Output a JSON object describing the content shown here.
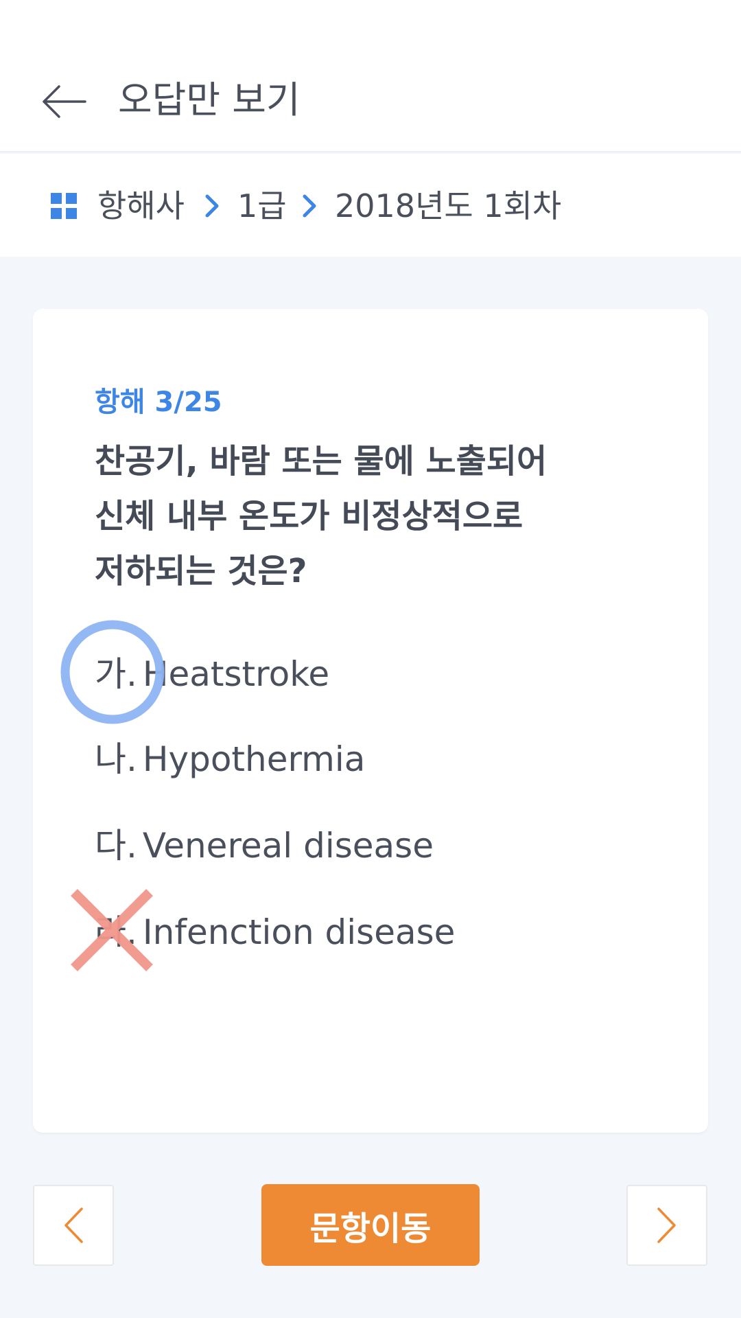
{
  "header": {
    "title": "오답만 보기",
    "back_icon": "arrow-left-icon"
  },
  "breadcrumb": {
    "icon": "grid-icon",
    "items": [
      "항해사",
      "1급",
      "2018년도 1회차"
    ],
    "separator_icon": "chevron-right-icon",
    "accent_color": "#3d86e6"
  },
  "question": {
    "number": "항해 3/25",
    "lines": [
      "찬공기, 바람 또는 물에 노출되어",
      "신체 내부 온도가 비정상적으로",
      "저하되는 것은?"
    ],
    "options": [
      {
        "mark": "가.",
        "text": "Heatstroke",
        "status": "correct"
      },
      {
        "mark": "나.",
        "text": "Hypothermia",
        "status": ""
      },
      {
        "mark": "다.",
        "text": "Venereal disease",
        "status": ""
      },
      {
        "mark": "라.",
        "text": "Infenction disease",
        "status": "wrong"
      }
    ],
    "correct_mark_color": "#8db4f2",
    "wrong_mark_color": "#f1968a"
  },
  "footer": {
    "prev_icon": "chevron-left-icon",
    "move_label": "문항이동",
    "next_icon": "chevron-right-icon",
    "accent_color": "#ee8a33"
  }
}
